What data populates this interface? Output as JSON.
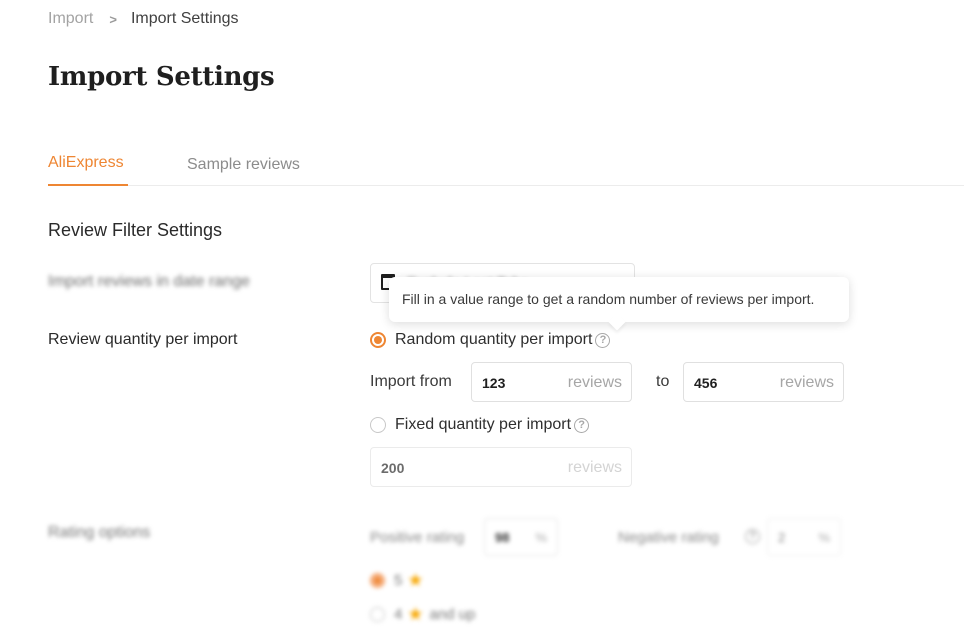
{
  "breadcrumb": {
    "root": "Import",
    "separator": ">",
    "current": "Import Settings"
  },
  "page_title": "Import Settings",
  "tabs": [
    {
      "label": "AliExpress",
      "active": true
    },
    {
      "label": "Sample reviews",
      "active": false
    }
  ],
  "colors": {
    "accent": "#ee8633",
    "star": "#f7a600"
  },
  "section_title": "Review Filter Settings",
  "date_range": {
    "label": "Import reviews in date range",
    "value": "Exclude Last Tabs",
    "icon": "calendar-icon"
  },
  "tooltip": {
    "text": "Fill in a value range to get a random number of reviews per import."
  },
  "quantity": {
    "label": "Review quantity per import",
    "random": {
      "label": "Random quantity per import",
      "checked": true,
      "help_icon": "?"
    },
    "import_from_label": "Import from",
    "from_value": "123",
    "to_label": "to",
    "to_value": "456",
    "suffix": "reviews",
    "fixed": {
      "label": "Fixed quantity per import",
      "checked": false,
      "help_icon": "?"
    },
    "fixed_value": "200",
    "fixed_suffix": "reviews"
  },
  "rating": {
    "label": "Rating options",
    "positive_label": "Positive rating",
    "positive_value": "98",
    "positive_suffix": "%",
    "negative_label": "Negative rating",
    "negative_help": "?",
    "negative_value": "2",
    "negative_suffix": "%",
    "options": [
      {
        "value": "5",
        "star": "★",
        "extra": "",
        "checked": true
      },
      {
        "value": "4",
        "star": "★",
        "extra": "and up",
        "checked": false
      }
    ]
  }
}
